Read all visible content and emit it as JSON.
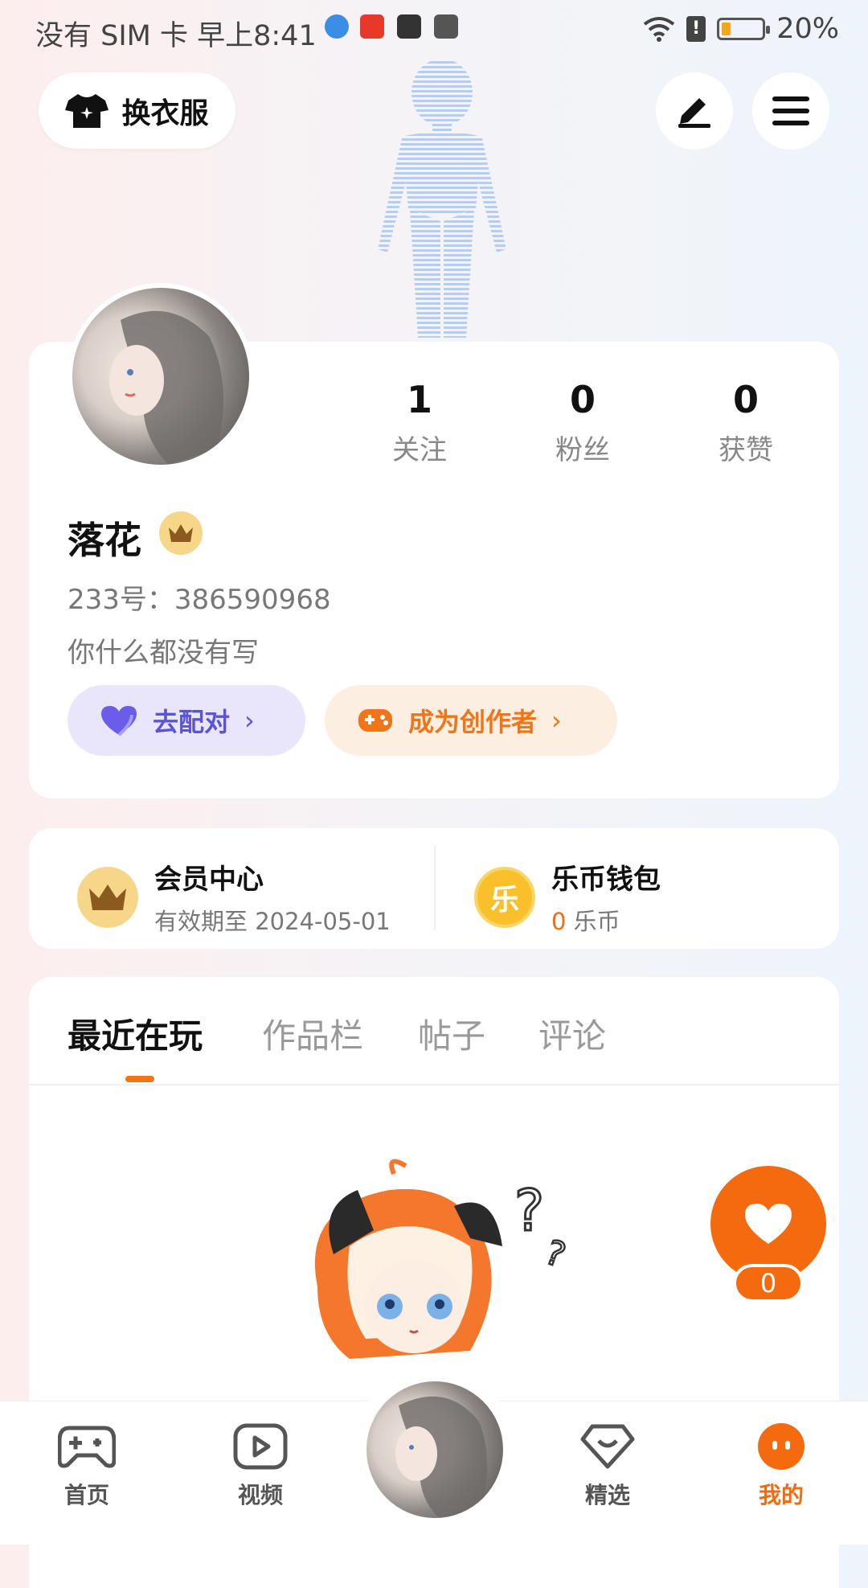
{
  "status_bar": {
    "left_text": "没有 SIM 卡 早上8:41",
    "battery_percent": "20%",
    "battery_level": 0.2
  },
  "header": {
    "change_clothes_label": "换衣服",
    "edit_icon": "edit-icon",
    "menu_icon": "menu-icon"
  },
  "profile": {
    "stats": [
      {
        "value": "1",
        "label": "关注"
      },
      {
        "value": "0",
        "label": "粉丝"
      },
      {
        "value": "0",
        "label": "获赞"
      }
    ],
    "username": "落花",
    "account_id": "233号：386590968",
    "bio": "你什么都没有写",
    "match_button": "去配对",
    "creator_button": "成为创作者"
  },
  "info_card": {
    "member_title": "会员中心",
    "member_sub": "有效期至 2024-05-01",
    "wallet_title": "乐币钱包",
    "wallet_amount": "0",
    "wallet_unit": "乐币",
    "wallet_icon_char": "乐"
  },
  "tabs": [
    "最近在玩",
    "作品栏",
    "帖子",
    "评论"
  ],
  "like": {
    "count": "0"
  },
  "bottom_nav": [
    {
      "label": "首页",
      "icon": "gamepad-icon"
    },
    {
      "label": "视频",
      "icon": "play-icon"
    },
    {
      "label": "精选",
      "icon": "heart-gem-icon"
    },
    {
      "label": "我的",
      "icon": "face-icon"
    }
  ],
  "colors": {
    "accent": "#f46a0e",
    "match_purple": "#5b54d8",
    "gold": "#f6d78a"
  }
}
